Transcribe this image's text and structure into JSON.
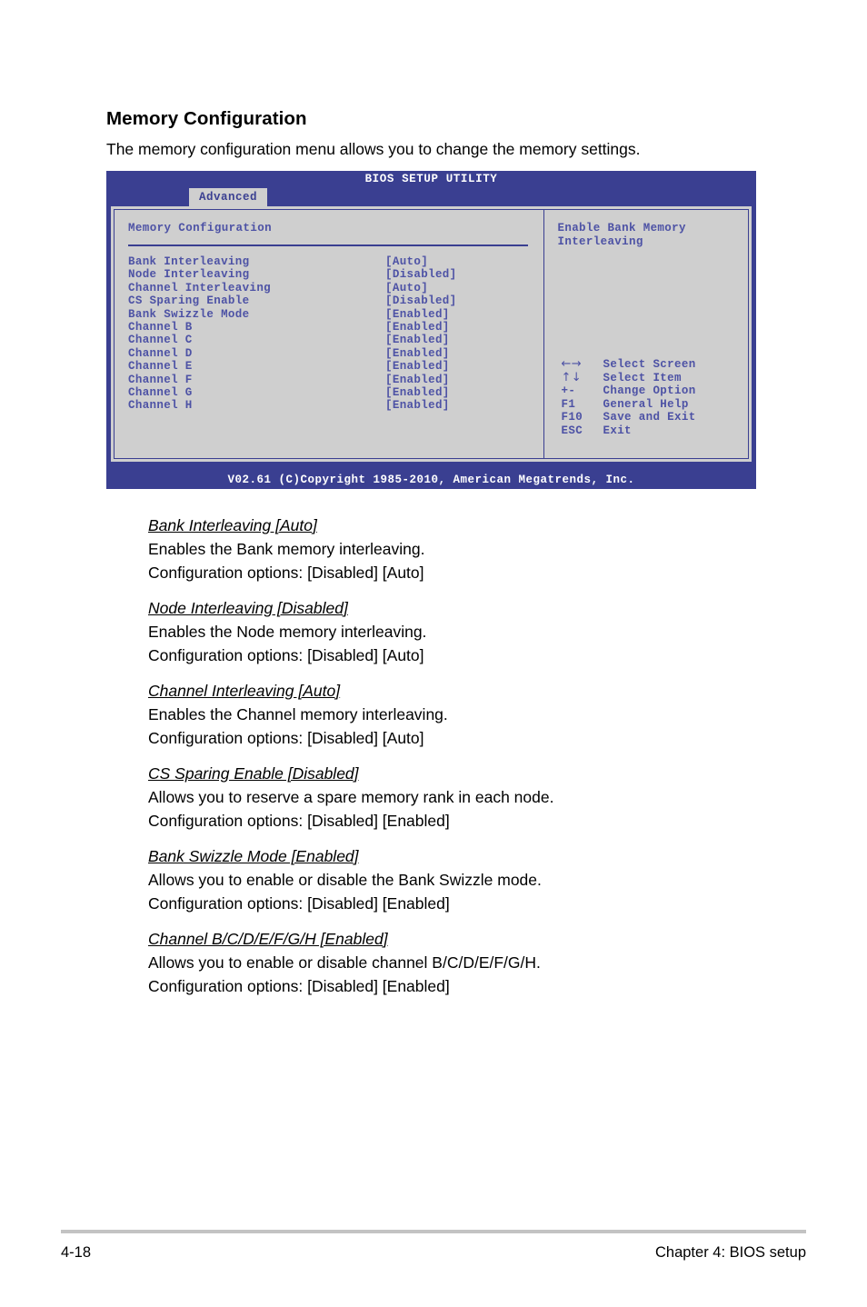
{
  "page": {
    "section_title": "Memory Configuration",
    "section_intro": "The memory configuration menu allows you to change the memory settings."
  },
  "bios": {
    "title": "BIOS SETUP UTILITY",
    "active_tab": "Advanced",
    "panel_heading": "Memory Configuration",
    "items": [
      {
        "label": "Bank Interleaving",
        "value": "[Auto]"
      },
      {
        "label": "Node Interleaving",
        "value": "[Disabled]"
      },
      {
        "label": "Channel Interleaving",
        "value": "[Auto]"
      },
      {
        "label": "CS Sparing Enable",
        "value": "[Disabled]"
      },
      {
        "label": "Bank Swizzle Mode",
        "value": "[Enabled]"
      },
      {
        "label": "Channel B",
        "value": "[Enabled]"
      },
      {
        "label": "Channel C",
        "value": "[Enabled]"
      },
      {
        "label": "Channel D",
        "value": "[Enabled]"
      },
      {
        "label": "Channel E",
        "value": "[Enabled]"
      },
      {
        "label": "Channel F",
        "value": "[Enabled]"
      },
      {
        "label": "Channel G",
        "value": "[Enabled]"
      },
      {
        "label": "Channel H",
        "value": "[Enabled]"
      }
    ],
    "help_text": "Enable Bank Memory Interleaving",
    "keys": [
      {
        "key": "←→",
        "action": "Select Screen",
        "symbol": true
      },
      {
        "key": "↑↓",
        "action": "Select Item",
        "symbol": true
      },
      {
        "key": "+-",
        "action": "Change Option",
        "symbol": false
      },
      {
        "key": "F1",
        "action": "General Help",
        "symbol": false
      },
      {
        "key": "F10",
        "action": "Save and Exit",
        "symbol": false
      },
      {
        "key": "ESC",
        "action": "Exit",
        "symbol": false
      }
    ],
    "footer": "V02.61 (C)Copyright 1985-2010, American Megatrends, Inc.",
    "colors": {
      "chrome_blue": "#3a3f91",
      "panel_gray": "#cfcfcf",
      "text_blue": "#4d52a5",
      "title_white": "#ffffff"
    }
  },
  "descriptions": [
    {
      "heading": "Bank Interleaving [Auto]",
      "line1": "Enables the Bank memory interleaving.",
      "line2": "Configuration options: [Disabled] [Auto]"
    },
    {
      "heading": "Node Interleaving [Disabled]",
      "line1": "Enables the Node memory interleaving.",
      "line2": "Configuration options: [Disabled] [Auto]"
    },
    {
      "heading": "Channel Interleaving [Auto]",
      "line1": "Enables the Channel memory interleaving.",
      "line2": "Configuration options: [Disabled] [Auto]"
    },
    {
      "heading": "CS Sparing Enable [Disabled]",
      "line1": "Allows you to reserve a spare memory rank in each node.",
      "line2": "Configuration options: [Disabled] [Enabled]"
    },
    {
      "heading": "Bank Swizzle Mode [Enabled]",
      "line1": "Allows you to enable or disable the Bank Swizzle mode.",
      "line2": "Configuration options: [Disabled] [Enabled]"
    },
    {
      "heading": "Channel B/C/D/E/F/G/H [Enabled]",
      "line1": "Allows you to enable or disable channel B/C/D/E/F/G/H.",
      "line2": "Configuration options: [Disabled] [Enabled]"
    }
  ],
  "footer": {
    "page_number": "4-18",
    "chapter": "Chapter 4: BIOS setup"
  }
}
